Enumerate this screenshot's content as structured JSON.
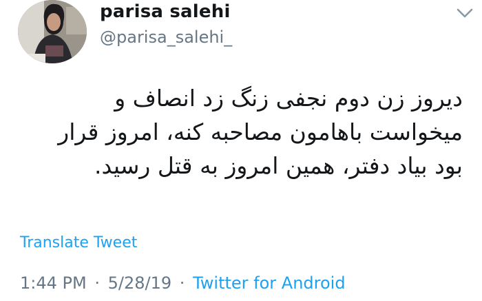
{
  "tweet": {
    "author": {
      "name": "parisa salehi",
      "handle": "@parisa_salehi_"
    },
    "body_lines": [
      "دیروز زن دوم نجفی زنگ زد انصاف و",
      "میخواست باهامون مصاحبه کنه، امروز قرار",
      "بود بیاد دفتر، همین امروز به قتل رسید."
    ],
    "translate_label": "Translate Tweet",
    "time": "1:44 PM",
    "date": "5/28/19",
    "separator": "·",
    "source": "Twitter for Android",
    "menu_icon": "chevron-down-icon"
  },
  "colors": {
    "text": "#14171a",
    "secondary": "#657786",
    "link": "#1da1f2",
    "background": "#ffffff"
  }
}
